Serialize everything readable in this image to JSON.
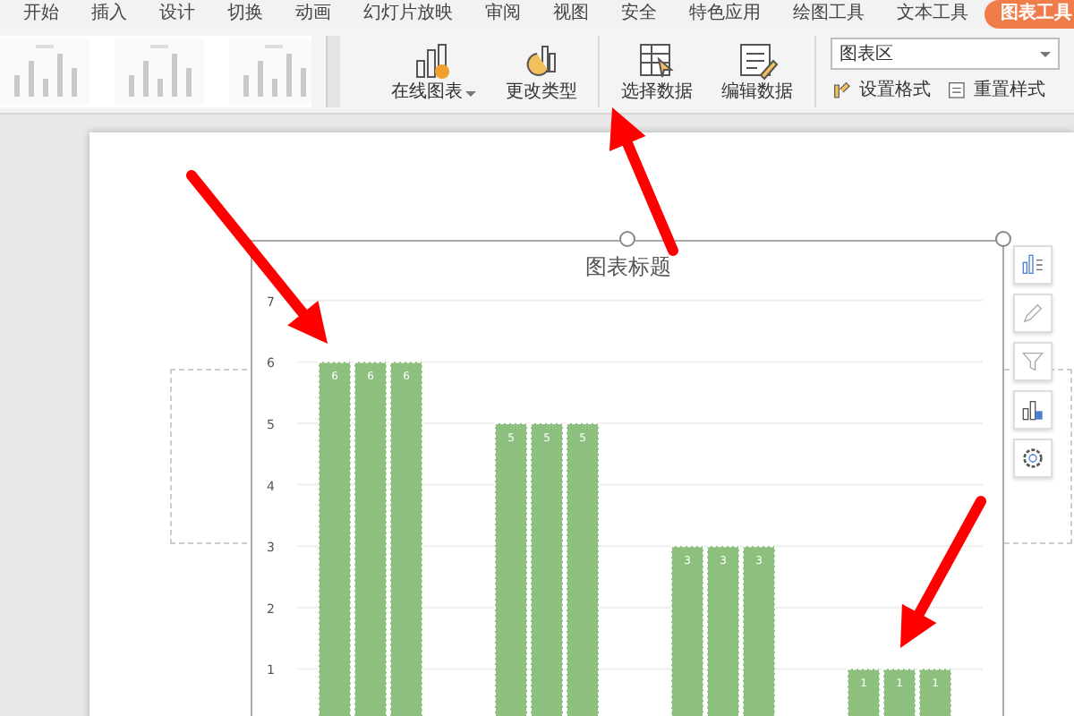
{
  "menu_tabs": [
    {
      "label": "开始",
      "selected": false
    },
    {
      "label": "插入",
      "selected": false
    },
    {
      "label": "设计",
      "selected": false
    },
    {
      "label": "切换",
      "selected": false
    },
    {
      "label": "动画",
      "selected": false
    },
    {
      "label": "幻灯片放映",
      "selected": false
    },
    {
      "label": "审阅",
      "selected": false
    },
    {
      "label": "视图",
      "selected": false
    },
    {
      "label": "安全",
      "selected": false
    },
    {
      "label": "特色应用",
      "selected": false
    },
    {
      "label": "绘图工具",
      "selected": false
    },
    {
      "label": "文本工具",
      "selected": false
    },
    {
      "label": "图表工具",
      "selected": true
    }
  ],
  "ribbon": {
    "chart_buttons": [
      {
        "kind": "online-chart",
        "label": "在线图表",
        "dropdown": true
      },
      {
        "kind": "change-type",
        "label": "更改类型",
        "dropdown": false
      }
    ],
    "data_buttons": [
      {
        "kind": "select-data",
        "label": "选择数据"
      },
      {
        "kind": "edit-data",
        "label": "编辑数据"
      }
    ],
    "element_select": {
      "value": "图表区"
    },
    "format_buttons": [
      {
        "kind": "format",
        "label": "设置格式"
      },
      {
        "kind": "reset",
        "label": "重置样式"
      }
    ]
  },
  "chart": {
    "chart_data": {
      "type": "bar",
      "title": "图表标题",
      "grid": true,
      "ylim": [
        0,
        7
      ],
      "yticks": [
        1,
        2,
        3,
        4,
        5,
        6,
        7
      ],
      "data_labels": true,
      "series": [
        {
          "color": "#8dbf7f",
          "values": [
            6,
            5,
            3,
            1
          ]
        },
        {
          "color": "#8dbf7f",
          "values": [
            6,
            5,
            3,
            1
          ]
        },
        {
          "color": "#8dbf7f",
          "values": [
            6,
            5,
            3,
            1
          ]
        }
      ]
    }
  }
}
